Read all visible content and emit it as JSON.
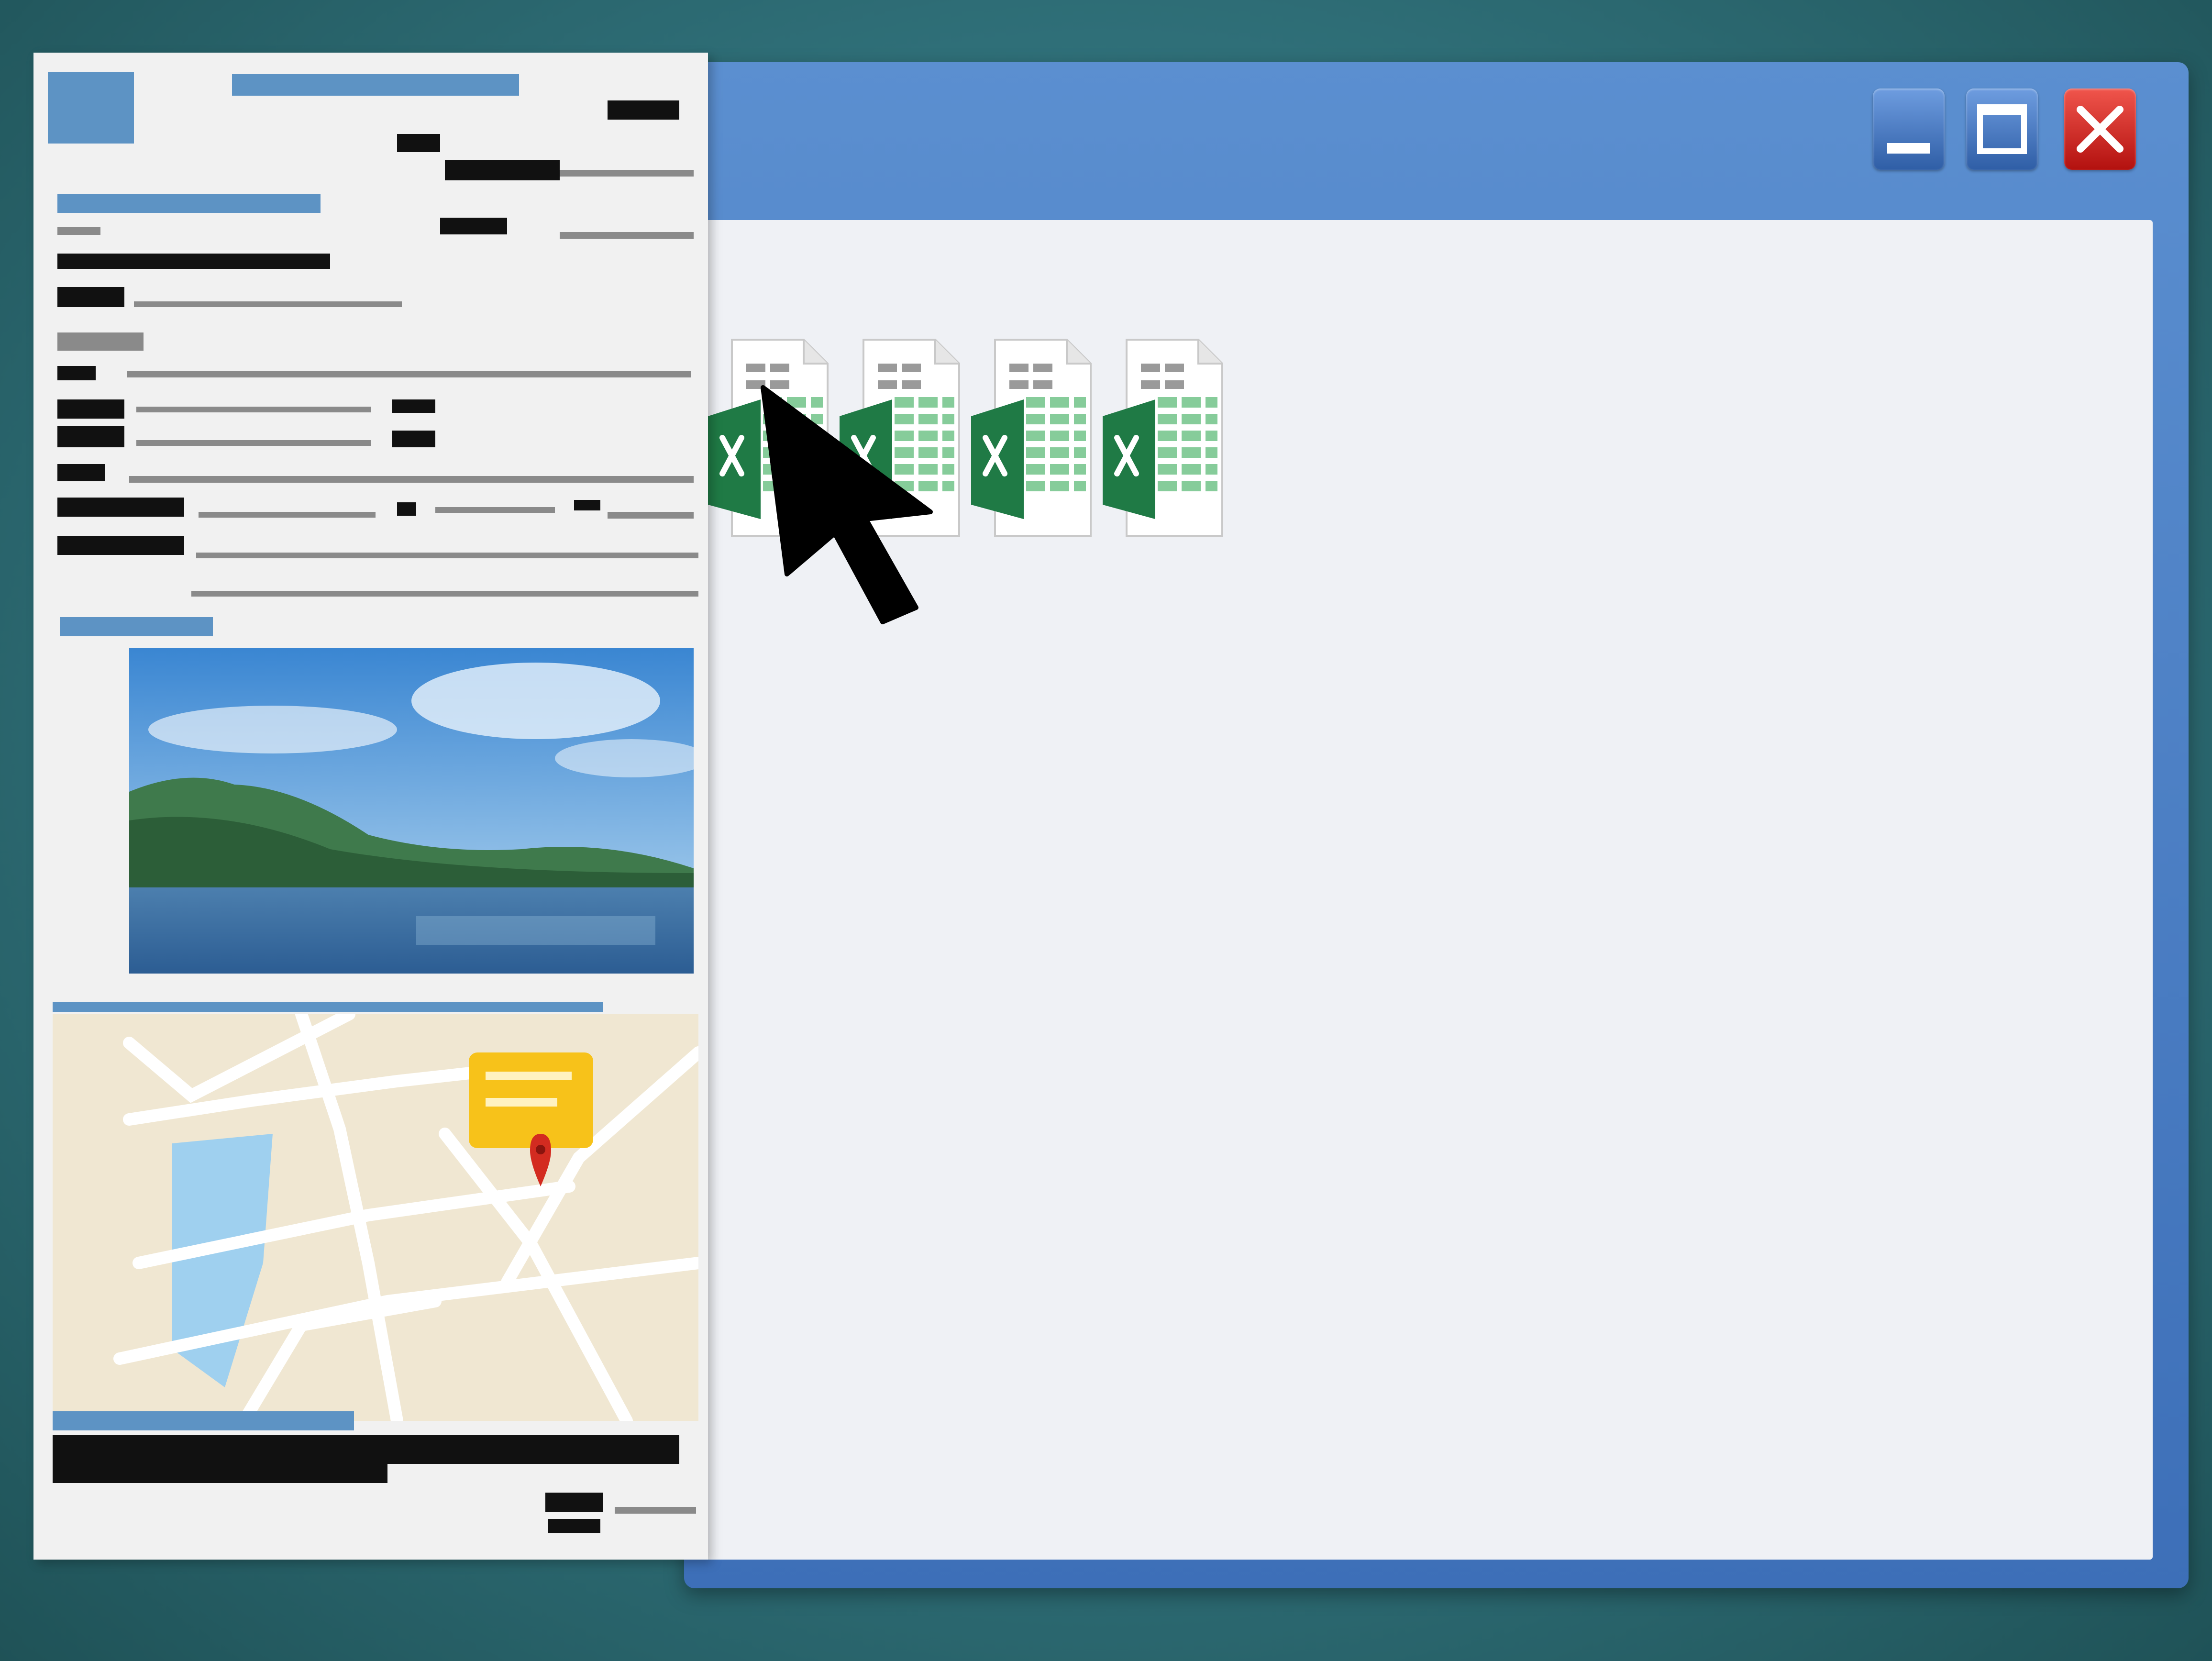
{
  "window": {
    "title": "",
    "controls": {
      "minimize": "minimize-icon",
      "maximize": "maximize-icon",
      "close": "close-icon"
    }
  },
  "files": [
    {
      "name": "",
      "icon": "excel-file-icon"
    },
    {
      "name": "",
      "icon": "excel-file-icon"
    },
    {
      "name": "",
      "icon": "excel-file-icon"
    },
    {
      "name": "",
      "icon": "excel-file-icon"
    }
  ],
  "document": {
    "photo": "landscape-lake-photo",
    "map": "street-map",
    "map_pin": "map-pin-icon"
  },
  "colors": {
    "titlebar": "#3d6fb8",
    "close": "#d9231f",
    "excel_green": "#1f7a45",
    "background": "#2f6f78"
  }
}
